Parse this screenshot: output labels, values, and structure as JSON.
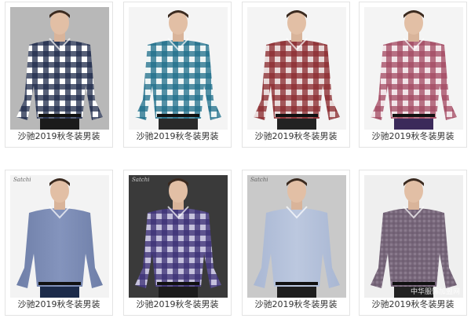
{
  "products": [
    {
      "caption": "沙驰2019秋冬装男装",
      "bg": "#b8b8b8",
      "shirt": [
        "#1f2b4a",
        "#ffffff"
      ],
      "pattern": "check",
      "pants": "#1b1b1b",
      "logo": ""
    },
    {
      "caption": "沙驰2019秋冬装男装",
      "bg": "#f4f4f4",
      "shirt": [
        "#1f6f8a",
        "#eef5f5"
      ],
      "pattern": "check",
      "pants": "#2a2a2a",
      "logo": ""
    },
    {
      "caption": "沙驰2019秋冬装男装",
      "bg": "#f4f4f4",
      "shirt": [
        "#8a2b2f",
        "#e9dada"
      ],
      "pattern": "check",
      "pants": "#222222",
      "logo": ""
    },
    {
      "caption": "沙驰2019秋冬装男装",
      "bg": "#f4f4f4",
      "shirt": [
        "#a34b63",
        "#f2e4e8"
      ],
      "pattern": "check",
      "pants": "#3b2a5a",
      "logo": ""
    },
    {
      "caption": "沙驰2019秋冬装男装",
      "bg": "#f3f3f3",
      "shirt": [
        "#6f7fa8",
        "#8494bd"
      ],
      "pattern": "solid",
      "pants": "#1c2b4a",
      "logo": "Satchi"
    },
    {
      "caption": "沙驰2019秋冬装男装",
      "bg": "#3a3a3a",
      "shirt": [
        "#3a2f74",
        "#c5c1dd"
      ],
      "pattern": "check",
      "pants": "#1c1c1c",
      "logo": "Satchi"
    },
    {
      "caption": "沙驰2019秋冬装男装",
      "bg": "#c9c9c9",
      "shirt": [
        "#a9b7d3",
        "#bcc8df"
      ],
      "pattern": "solid",
      "pants": "#1e1e1e",
      "logo": "Satchi"
    },
    {
      "caption": "沙驰2019秋冬装男装",
      "bg": "#efefef",
      "shirt": [
        "#6a5a6e",
        "#8a7a8d"
      ],
      "pattern": "fine",
      "pants": "#222222",
      "logo": ""
    }
  ],
  "watermark": "中华服饰加盟网"
}
